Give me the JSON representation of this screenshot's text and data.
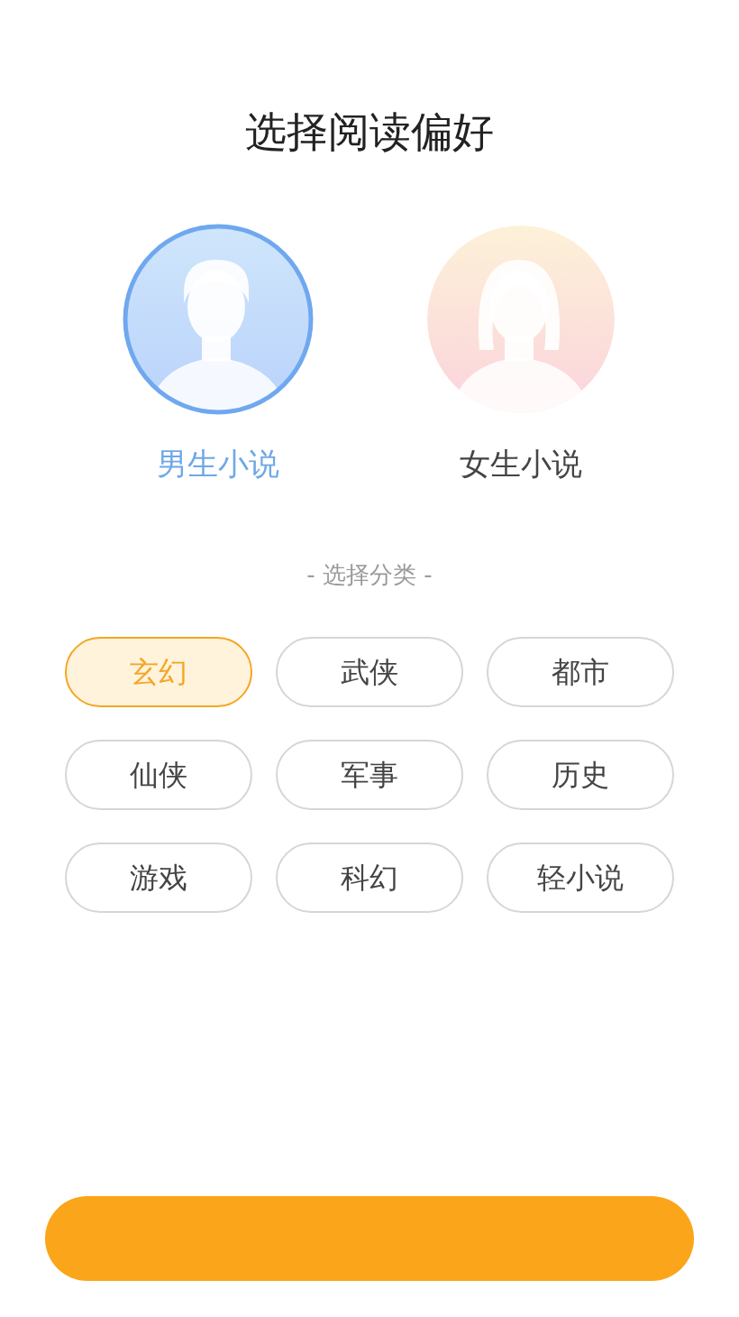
{
  "title": "选择阅读偏好",
  "genders": [
    {
      "label": "男生小说",
      "kind": "male",
      "selected": true
    },
    {
      "label": "女生小说",
      "kind": "female",
      "selected": false
    }
  ],
  "category_heading": "- 选择分类 -",
  "categories": [
    {
      "label": "玄幻",
      "selected": true
    },
    {
      "label": "武侠",
      "selected": false
    },
    {
      "label": "都市",
      "selected": false
    },
    {
      "label": "仙侠",
      "selected": false
    },
    {
      "label": "军事",
      "selected": false
    },
    {
      "label": "历史",
      "selected": false
    },
    {
      "label": "游戏",
      "selected": false
    },
    {
      "label": "科幻",
      "selected": false
    },
    {
      "label": "轻小说",
      "selected": false
    }
  ]
}
